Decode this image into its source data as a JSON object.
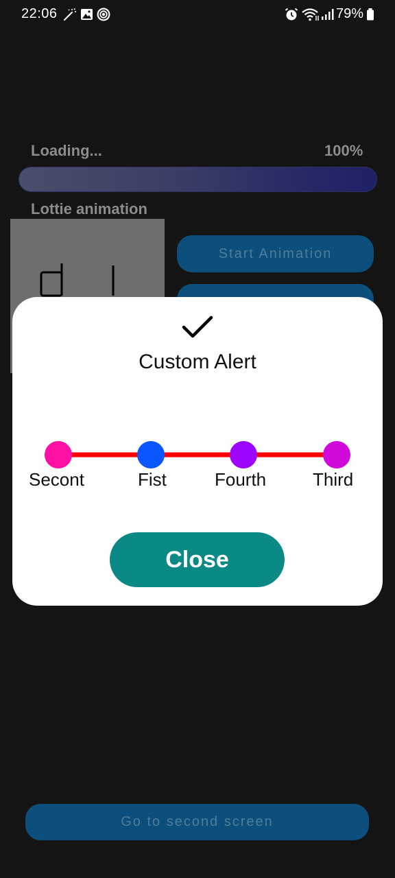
{
  "status_bar": {
    "time": "22:06",
    "battery_percent": "79%",
    "left_icons": [
      "magic-wand-icon",
      "image-icon",
      "vpn-icon"
    ],
    "right_icons": [
      "alarm-icon",
      "wifi-icon",
      "signal-icon",
      "battery-icon"
    ]
  },
  "background_screen": {
    "loading_label": "Loading...",
    "loading_percent": "100%",
    "progress_fraction": 1.0,
    "lottie_label": "Lottie animation",
    "start_animation_label": "Start Animation",
    "go_second_screen_label": "Go to second screen"
  },
  "dialog": {
    "icon": "checkmark-icon",
    "title": "Custom Alert",
    "timeline": {
      "line_color": "#ff0000",
      "steps": [
        {
          "label": "Secont",
          "color": "#ff10a4"
        },
        {
          "label": "Fist",
          "color": "#0b57ff"
        },
        {
          "label": "Fourth",
          "color": "#9d05ff"
        },
        {
          "label": "Third",
          "color": "#d00adb"
        }
      ]
    },
    "close_label": "Close"
  },
  "colors": {
    "background": "#141414",
    "dialog_background": "#ffffff",
    "close_button": "#0b8a85",
    "background_button": "#0d4f7c"
  }
}
